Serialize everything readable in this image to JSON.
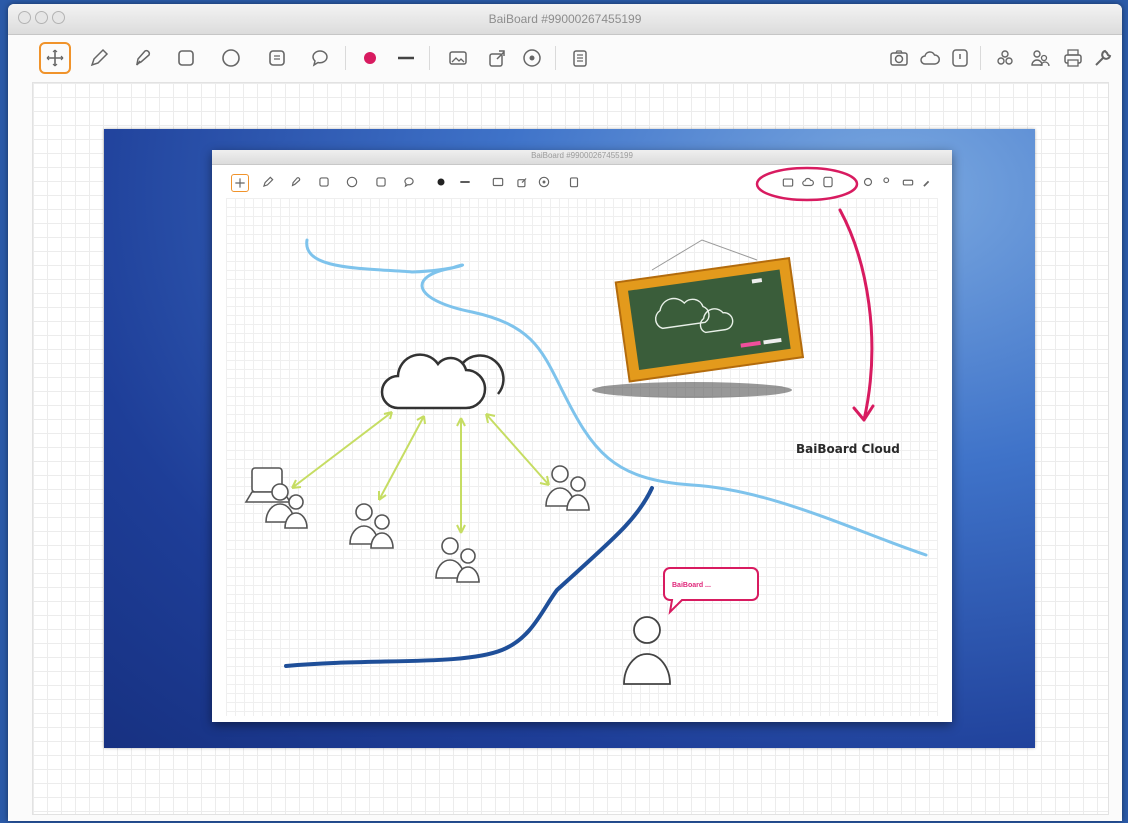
{
  "window": {
    "title": "BaiBoard #99000267455199"
  },
  "toolbar": {
    "left_tools": [
      {
        "name": "move-tool",
        "icon": "plus-crosshair-icon",
        "active": true
      },
      {
        "name": "pen-tool",
        "icon": "pencil-icon"
      },
      {
        "name": "marker-tool",
        "icon": "marker-icon"
      },
      {
        "name": "rectangle-tool",
        "icon": "rounded-square-icon"
      },
      {
        "name": "circle-tool",
        "icon": "circle-icon"
      },
      {
        "name": "note-tool",
        "icon": "note-icon"
      },
      {
        "name": "speech-tool",
        "icon": "speech-bubble-icon"
      },
      {
        "name": "color-picker",
        "icon": "color-dot-icon",
        "color": "#d81b60"
      },
      {
        "name": "line-width",
        "icon": "line-icon"
      },
      {
        "name": "image-tool",
        "icon": "image-icon"
      },
      {
        "name": "export-tool",
        "icon": "export-icon"
      },
      {
        "name": "target-tool",
        "icon": "target-icon"
      },
      {
        "name": "clipboard-tool",
        "icon": "clipboard-icon"
      }
    ],
    "right_tools": [
      {
        "name": "camera",
        "icon": "camera-icon"
      },
      {
        "name": "cloud",
        "icon": "cloud-icon"
      },
      {
        "name": "save",
        "icon": "save-icon"
      },
      {
        "name": "share",
        "icon": "share-icon"
      },
      {
        "name": "users",
        "icon": "users-icon"
      },
      {
        "name": "print",
        "icon": "print-icon"
      },
      {
        "name": "settings",
        "icon": "wrench-icon"
      }
    ]
  },
  "embedded": {
    "title": "BaiBoard #99000267455199",
    "annotation_label": "BaiBoard Cloud",
    "bubble_text": "BaiBoard ..."
  },
  "colors": {
    "accent": "#f0932b",
    "ink_pink": "#d81b60",
    "light_blue": "#7ec3ec",
    "dark_blue": "#1f4f99",
    "arrow_green": "#c6dd63",
    "chalkboard": "#3a5d3a",
    "frame": "#e39a1c"
  }
}
